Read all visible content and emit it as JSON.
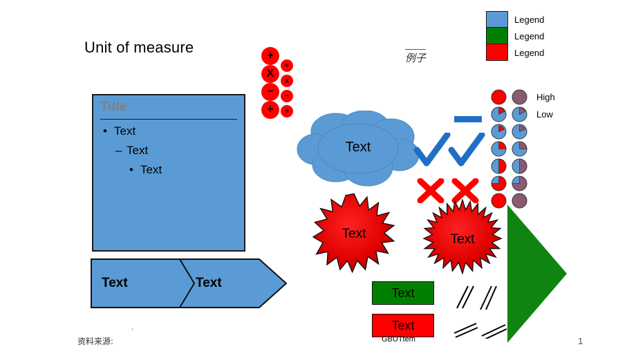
{
  "slide": {
    "title": "Unit of measure",
    "page_number": "1",
    "example_stamp": "例子",
    "footer_source": "资料来源:",
    "footer_dot": "."
  },
  "content_box": {
    "title": "Title",
    "bullets": [
      {
        "marker": "•",
        "text": "Text"
      },
      {
        "marker": "–",
        "text": "Text"
      },
      {
        "marker": "•",
        "text": "Text"
      }
    ]
  },
  "chevron_arrow": {
    "segments": [
      {
        "label": "Text"
      },
      {
        "label": "Text"
      }
    ]
  },
  "operator_circles": {
    "large": [
      {
        "symbol": "+"
      },
      {
        "symbol": "X"
      },
      {
        "symbol": "−"
      },
      {
        "symbol": "÷"
      }
    ],
    "small": [
      {
        "symbol": "+"
      },
      {
        "symbol": "x"
      },
      {
        "symbol": "−"
      },
      {
        "symbol": "÷"
      }
    ]
  },
  "cloud": {
    "label": "Text"
  },
  "starbursts": [
    {
      "label": "Text"
    },
    {
      "label": "Text"
    }
  ],
  "status_boxes": [
    {
      "label": "Text",
      "color": "#008000"
    },
    {
      "label": "Text",
      "color": "#FF0000"
    }
  ],
  "gbu_caption": "GBUTtem",
  "legend": {
    "items": [
      {
        "label": "Legend",
        "color": "#5B9BD5"
      },
      {
        "label": "Legend",
        "color": "#008000"
      },
      {
        "label": "Legend",
        "color": "#FF0000"
      }
    ]
  },
  "harvey_matrix": {
    "rows": [
      {
        "label": "High",
        "fill": 100
      },
      {
        "label": "Low",
        "fill": 12
      },
      {
        "label": "",
        "fill": 25
      },
      {
        "label": "",
        "fill": 30
      },
      {
        "label": "",
        "fill": 50
      },
      {
        "label": "",
        "fill": 75
      },
      {
        "label": "",
        "fill": 100
      }
    ],
    "column_colors": [
      "#FF0000",
      "#8A5A72"
    ],
    "base_color": "#5B9BD5"
  },
  "marks": {
    "checks": 2,
    "crosses": 2,
    "check_color": "#1F6FC4",
    "cross_color": "#FF0000",
    "bar_color": "#1F6FC4"
  },
  "colors": {
    "accent_blue": "#5B9BD5",
    "green": "#008000",
    "red": "#FF0000",
    "purple": "#8A5A72",
    "outline": "#1a1a1a"
  }
}
